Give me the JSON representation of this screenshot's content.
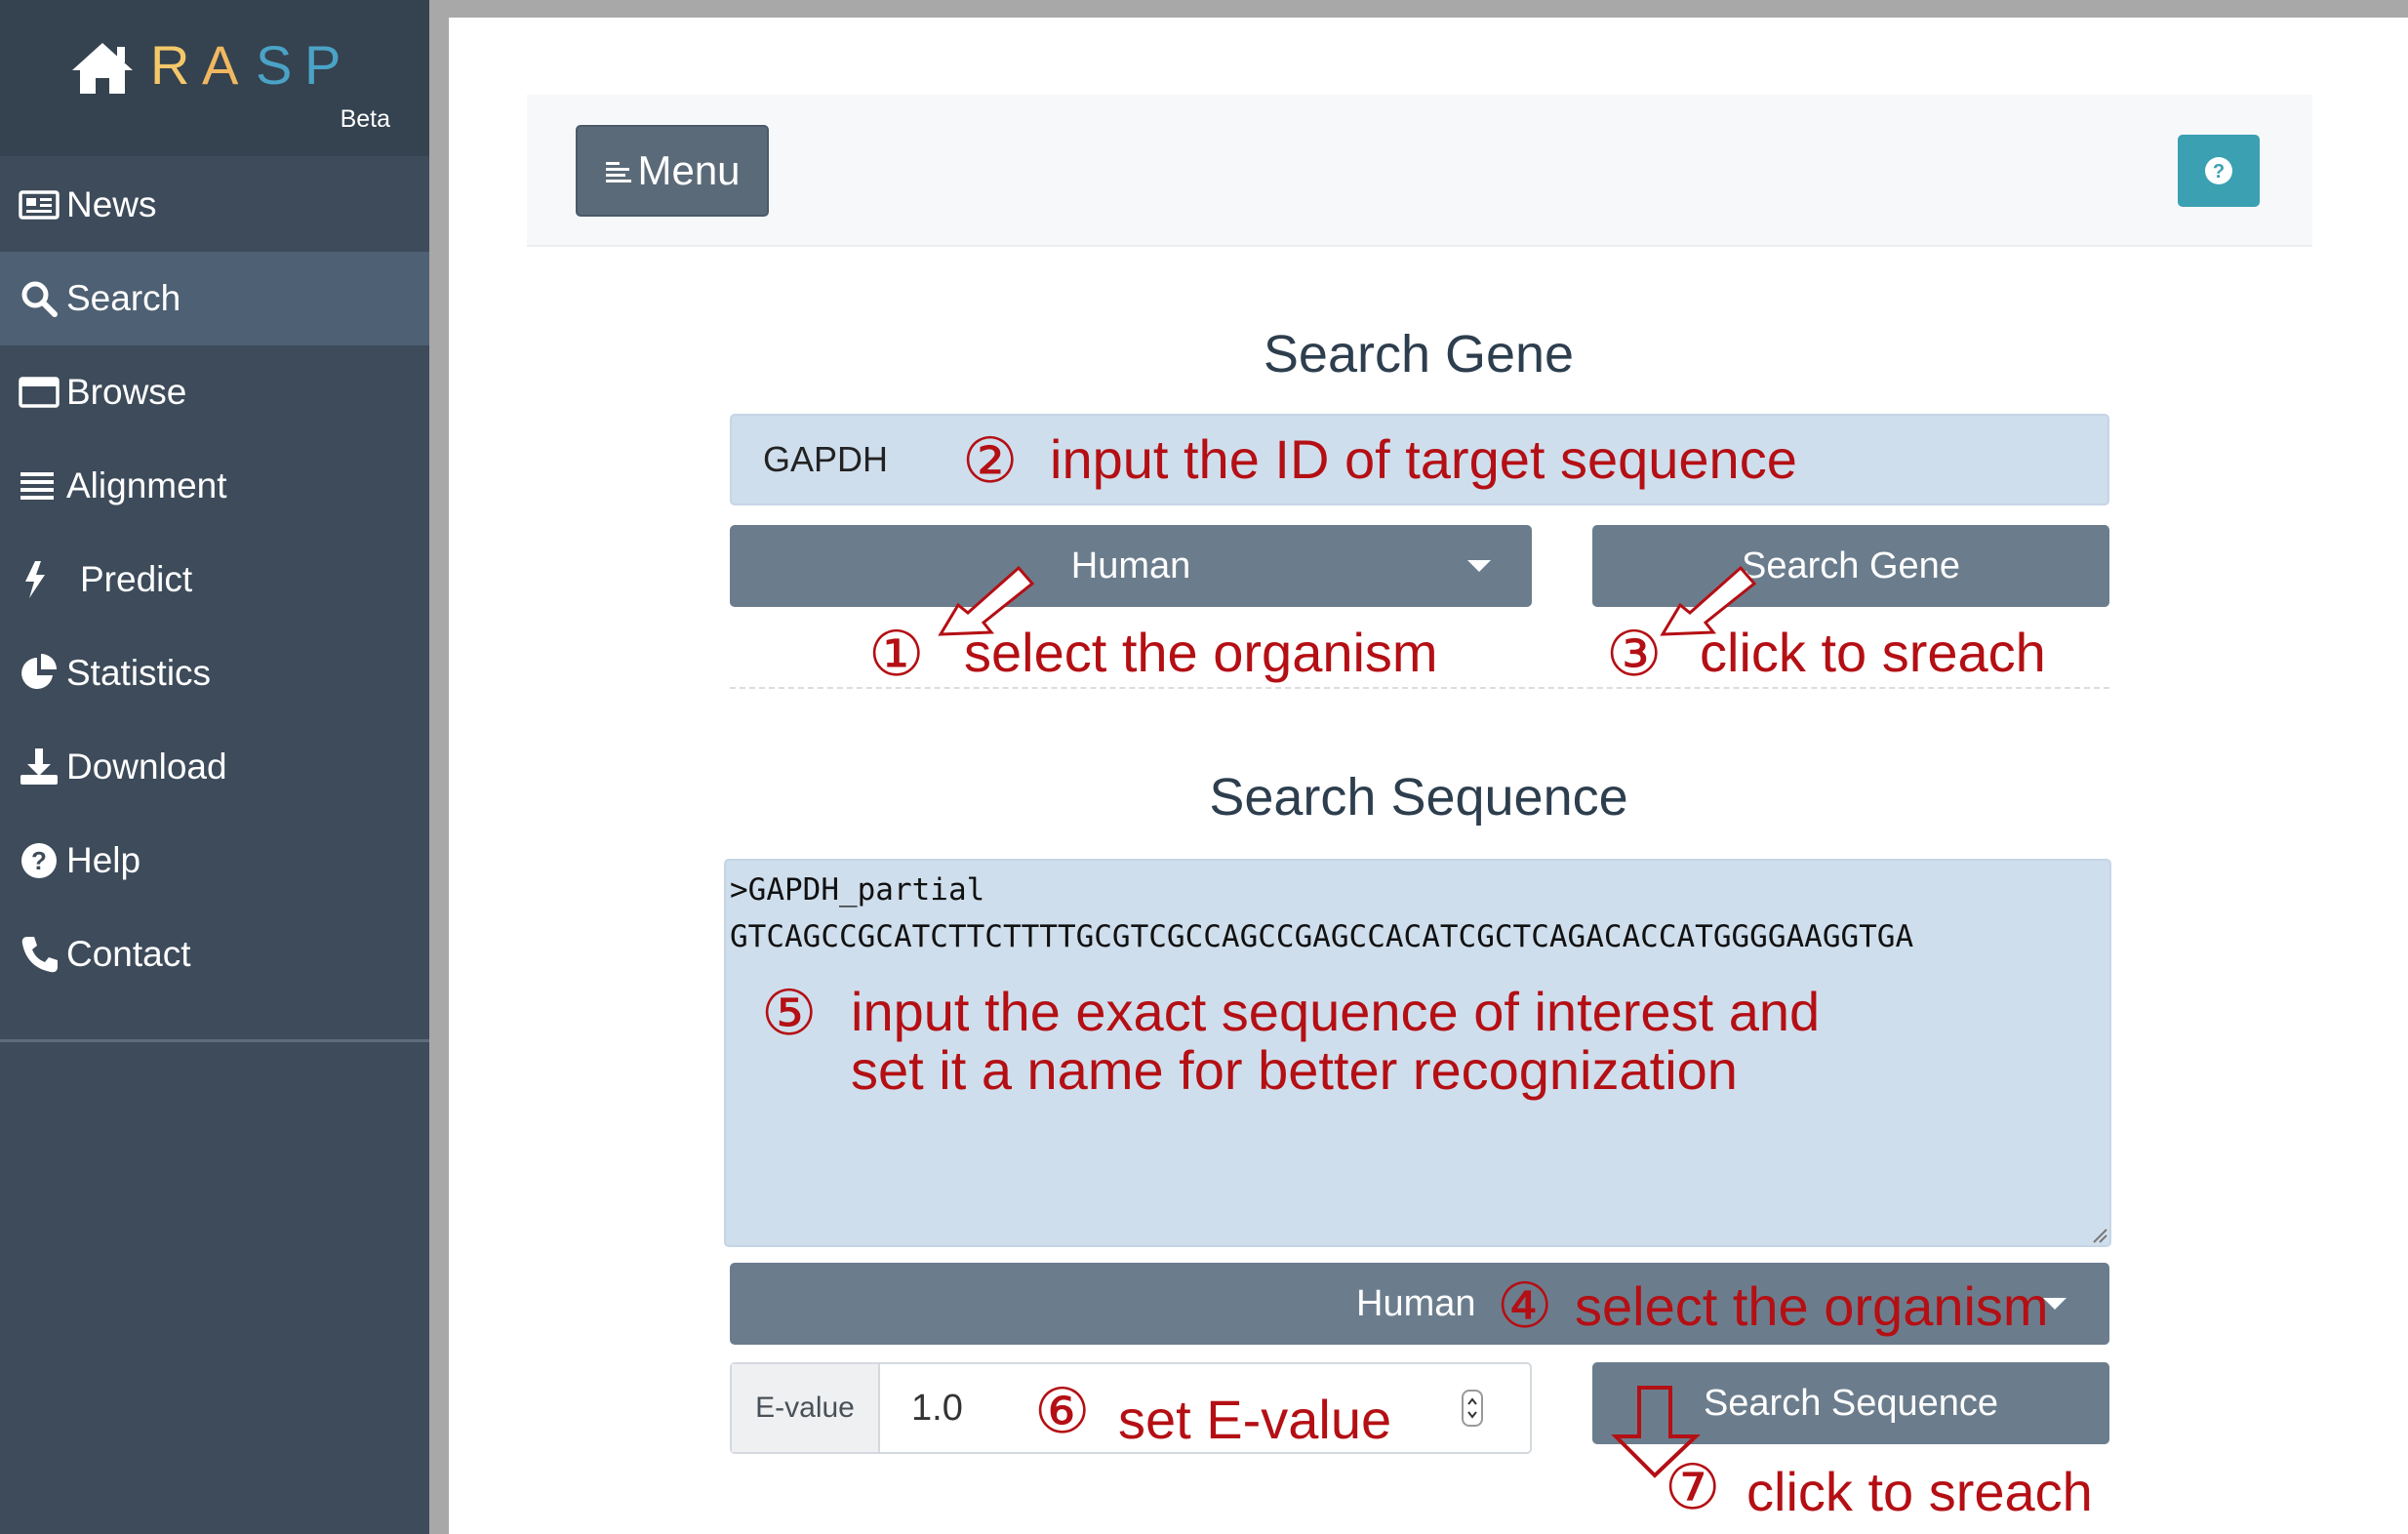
{
  "brand": {
    "letters": [
      "R",
      "A",
      "S",
      "P"
    ],
    "beta": "Beta",
    "colors": [
      "#f4c86a",
      "#f0b860",
      "#4aa3c6",
      "#4aa3c6"
    ]
  },
  "nav": {
    "items": [
      {
        "label": "News",
        "icon": "newspaper-icon"
      },
      {
        "label": "Search",
        "icon": "search-icon",
        "active": true
      },
      {
        "label": "Browse",
        "icon": "window-icon"
      },
      {
        "label": "Alignment",
        "icon": "align-icon"
      },
      {
        "label": "Predict",
        "icon": "bolt-icon"
      },
      {
        "label": "Statistics",
        "icon": "pie-chart-icon"
      },
      {
        "label": "Download",
        "icon": "download-icon"
      },
      {
        "label": "Help",
        "icon": "question-circle-icon"
      },
      {
        "label": "Contact",
        "icon": "phone-icon"
      }
    ]
  },
  "toolbar": {
    "menu_label": "Menu",
    "help_icon": "question-circle-icon"
  },
  "search_gene": {
    "title": "Search Gene",
    "input_value": "GAPDH",
    "organism": "Human",
    "button_label": "Search Gene"
  },
  "search_sequence": {
    "title": "Search Sequence",
    "line1": ">GAPDH_partial",
    "line2": "GTCAGCCGCATCTTCTTTTGCGTCGCCAGCCGAGCCACATCGCTCAGACACCATGGGGAAGGTGA",
    "organism": "Human",
    "evalue_label": "E-value",
    "evalue_value": "1.0",
    "button_label": "Search Sequence"
  },
  "annotations": {
    "n1": "①",
    "t1": "select the organism",
    "n2": "②",
    "t2": "input the ID of target sequence",
    "n3": "③",
    "t3": "click to sreach",
    "n4": "④",
    "t4": "select the organism",
    "n5": "⑤",
    "t5a": "input the exact sequence of interest and",
    "t5b": "set it a name for better recognization",
    "n6": "⑥",
    "t6": "set E-value",
    "n7": "⑦",
    "t7": "click to sreach"
  },
  "colors": {
    "sidebar": "#3d4b5a",
    "sidebar_active": "#4e6073",
    "button_gray": "#6b7d8d",
    "help_teal": "#3aa0b2",
    "input_blue": "#cfdeec",
    "annotation_red": "#b40f14"
  }
}
